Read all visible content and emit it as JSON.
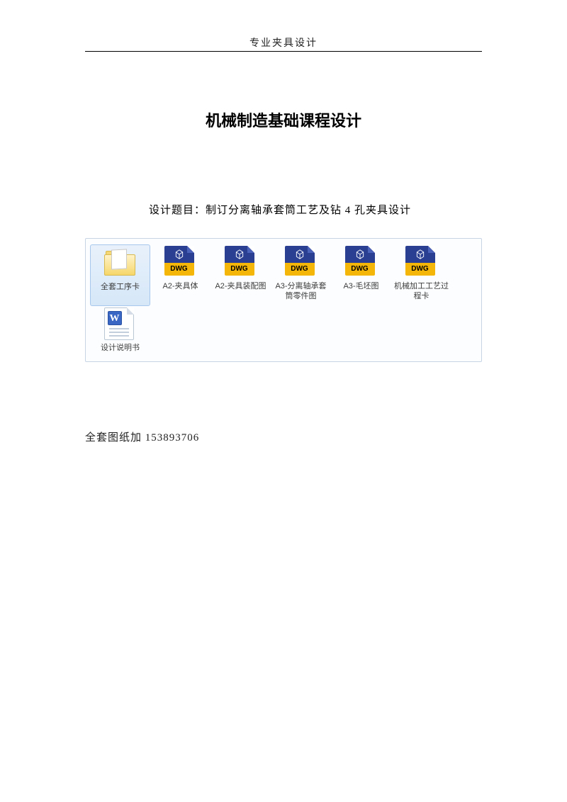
{
  "header": "专业夹具设计",
  "title": "机械制造基础课程设计",
  "subtitle": "设计题目：制订分离轴承套筒工艺及钻 4 孔夹具设计",
  "contact": "全套图纸加 153893706",
  "dwg_badge": "DWG",
  "word_badge": "W",
  "files": {
    "row1": [
      {
        "label": "全套工序卡",
        "type": "folder",
        "selected": true
      },
      {
        "label": "A2-夹具体",
        "type": "dwg"
      },
      {
        "label": "A2-夹具装配图",
        "type": "dwg"
      },
      {
        "label": "A3-分离轴承套筒零件图",
        "type": "dwg"
      },
      {
        "label": "A3-毛坯图",
        "type": "dwg"
      },
      {
        "label": "机械加工工艺过程卡",
        "type": "dwg"
      }
    ],
    "row2": [
      {
        "label": "设计说明书",
        "type": "word"
      }
    ]
  }
}
